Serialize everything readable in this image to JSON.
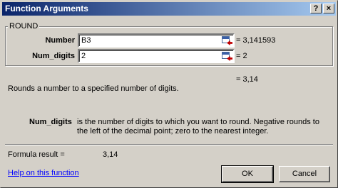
{
  "window": {
    "title": "Function Arguments",
    "help_glyph": "?",
    "close_glyph": "×"
  },
  "function": {
    "name": "ROUND",
    "args": [
      {
        "label": "Number",
        "value": "B3",
        "result": "= 3,141593"
      },
      {
        "label": "Num_digits",
        "value": "2",
        "result": "= 2"
      }
    ],
    "function_result": "= 3,14",
    "description": "Rounds a number to a specified number of digits.",
    "arg_help_name": "Num_digits",
    "arg_help_line1": "is the number of digits to which you want to round. Negative rounds to",
    "arg_help_line2": "the left of the decimal point; zero to the nearest integer."
  },
  "formula": {
    "label": "Formula result =",
    "value": "3,14"
  },
  "footer": {
    "help_link": "Help on this function",
    "ok_label": "OK",
    "cancel_label": "Cancel"
  }
}
